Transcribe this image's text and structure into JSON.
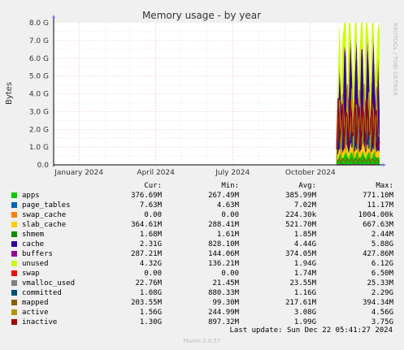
{
  "chart_data": {
    "type": "area",
    "title": "Memory usage - by year",
    "ylabel": "Bytes",
    "watermark": "RRDTOOL / TOBI OETIKER",
    "ylim": [
      0,
      8.0
    ],
    "y_unit": "G",
    "y_ticks": [
      "0.0",
      "1.0 G",
      "2.0 G",
      "3.0 G",
      "4.0 G",
      "5.0 G",
      "6.0 G",
      "7.0 G",
      "8.0 G"
    ],
    "x_ticks": [
      "January 2024",
      "April 2024",
      "July 2024",
      "October 2024"
    ],
    "x_tick_dates": [
      "2024-01-01",
      "2024-04-01",
      "2024-07-01",
      "2024-10-01"
    ],
    "x_range": [
      "2023-12-02",
      "2024-12-22"
    ],
    "data_start": "2024-11-01",
    "grid": true,
    "columns": [
      "Cur:",
      "Min:",
      "Avg:",
      "Max:"
    ],
    "series": [
      {
        "name": "apps",
        "color": "#00cc00",
        "cur": "376.69M",
        "min": "267.49M",
        "avg": "385.99M",
        "max": "771.10M"
      },
      {
        "name": "page_tables",
        "color": "#0066b3",
        "cur": "7.63M",
        "min": "4.63M",
        "avg": "7.02M",
        "max": "11.17M"
      },
      {
        "name": "swap_cache",
        "color": "#ff8000",
        "cur": "0.00",
        "min": "0.00",
        "avg": "224.30k",
        "max": "1004.00k"
      },
      {
        "name": "slab_cache",
        "color": "#ffcc00",
        "cur": "364.61M",
        "min": "288.41M",
        "avg": "521.70M",
        "max": "667.63M"
      },
      {
        "name": "shmem",
        "color": "#008f00",
        "cur": "1.68M",
        "min": "1.61M",
        "avg": "1.85M",
        "max": "2.44M"
      },
      {
        "name": "cache",
        "color": "#330099",
        "cur": "2.31G",
        "min": "828.10M",
        "avg": "4.44G",
        "max": "5.88G"
      },
      {
        "name": "buffers",
        "color": "#990099",
        "cur": "287.21M",
        "min": "144.06M",
        "avg": "374.05M",
        "max": "427.86M"
      },
      {
        "name": "unused",
        "color": "#ccff00",
        "cur": "4.32G",
        "min": "136.21M",
        "avg": "1.94G",
        "max": "6.12G"
      },
      {
        "name": "swap",
        "color": "#ff0000",
        "cur": "0.00",
        "min": "0.00",
        "avg": "1.74M",
        "max": "6.50M"
      },
      {
        "name": "vmalloc_used",
        "color": "#808080",
        "cur": "22.76M",
        "min": "21.45M",
        "avg": "23.55M",
        "max": "25.33M"
      },
      {
        "name": "committed",
        "color": "#004d80",
        "cur": "1.08G",
        "min": "880.33M",
        "avg": "1.16G",
        "max": "2.29G"
      },
      {
        "name": "mapped",
        "color": "#8c5c00",
        "cur": "203.55M",
        "min": "99.30M",
        "avg": "217.61M",
        "max": "394.34M"
      },
      {
        "name": "active",
        "color": "#b39700",
        "cur": "1.56G",
        "min": "244.99M",
        "avg": "3.08G",
        "max": "4.56G"
      },
      {
        "name": "inactive",
        "color": "#a80000",
        "cur": "1.30G",
        "min": "897.32M",
        "avg": "1.99G",
        "max": "3.75G"
      }
    ]
  },
  "footer": {
    "last_update": "Last update: Sun Dec 22 05:41:27 2024",
    "version": "Munin 2.0.57"
  }
}
